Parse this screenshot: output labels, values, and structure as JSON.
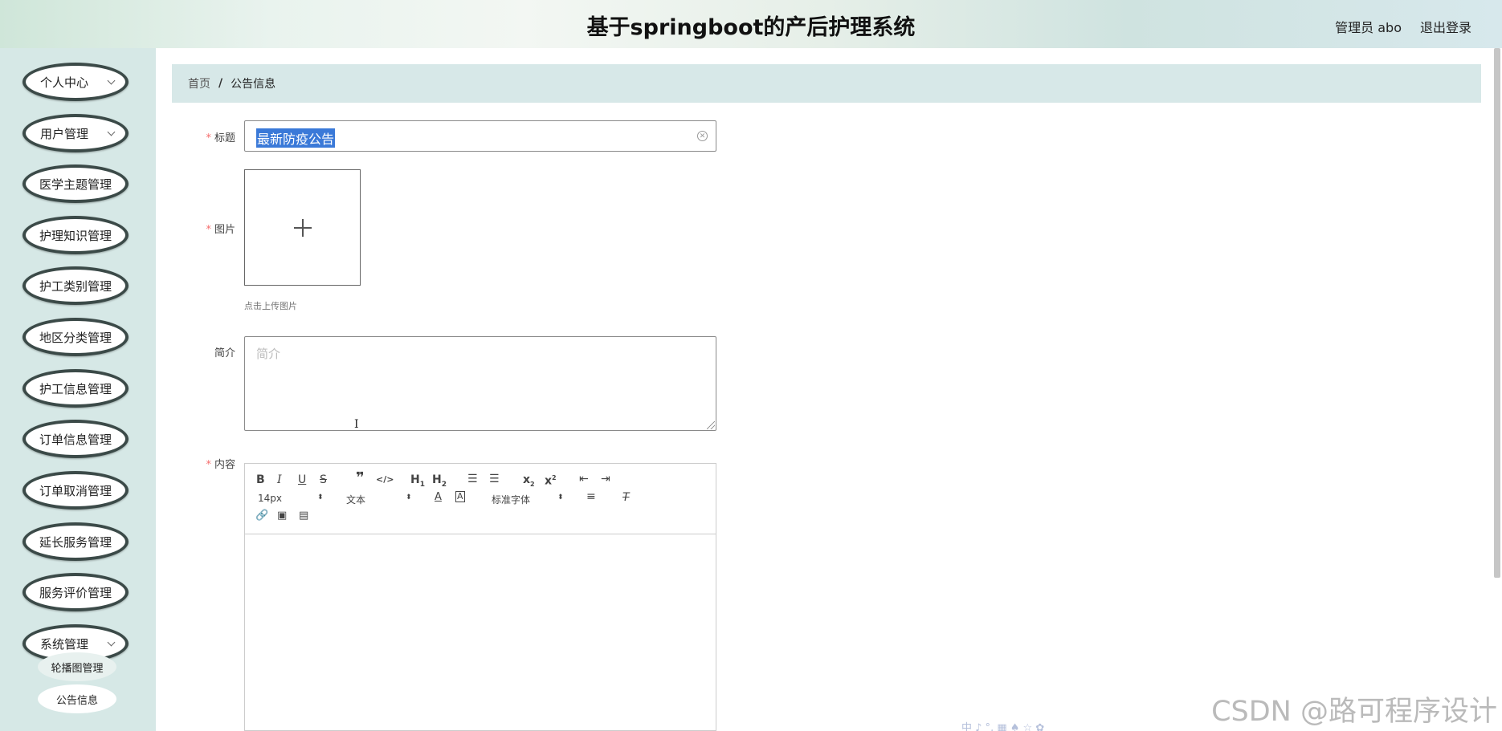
{
  "header": {
    "title": "基于springboot的产后护理系统",
    "user": "管理员 abo",
    "logout": "退出登录"
  },
  "sidebar": {
    "items": [
      {
        "label": "个人中心",
        "has_sub": true
      },
      {
        "label": "用户管理",
        "has_sub": true
      },
      {
        "label": "医学主题管理",
        "has_sub": false
      },
      {
        "label": "护理知识管理",
        "has_sub": false
      },
      {
        "label": "护工类别管理",
        "has_sub": false
      },
      {
        "label": "地区分类管理",
        "has_sub": false
      },
      {
        "label": "护工信息管理",
        "has_sub": false
      },
      {
        "label": "订单信息管理",
        "has_sub": false
      },
      {
        "label": "订单取消管理",
        "has_sub": false
      },
      {
        "label": "延长服务管理",
        "has_sub": false
      },
      {
        "label": "服务评价管理",
        "has_sub": false
      },
      {
        "label": "系统管理",
        "has_sub": true
      }
    ],
    "sub_items": [
      {
        "label": "轮播图管理"
      },
      {
        "label": "公告信息",
        "active": true
      }
    ]
  },
  "breadcrumb": {
    "home": "首页",
    "separator": "/",
    "current": "公告信息"
  },
  "form": {
    "title_label": "标题",
    "title_value": "最新防疫公告",
    "image_label": "图片",
    "upload_tip": "点击上传图片",
    "desc_label": "简介",
    "desc_placeholder": "简介",
    "content_label": "内容"
  },
  "editor": {
    "font_size": "14px",
    "header_select": "文本",
    "font_family": "标准字体",
    "buttons": [
      "bold",
      "italic",
      "underline",
      "strike",
      "blockquote",
      "code-block",
      "h1",
      "h2",
      "ordered-list",
      "bullet-list",
      "subscript",
      "superscript",
      "outdent",
      "indent",
      "font-color",
      "background-color",
      "align",
      "clean",
      "link",
      "image",
      "video"
    ]
  },
  "watermark": "CSDN @路可程序设计",
  "ime_bar": "中 ♪ °, ▦ ♠ ☆ ✿"
}
